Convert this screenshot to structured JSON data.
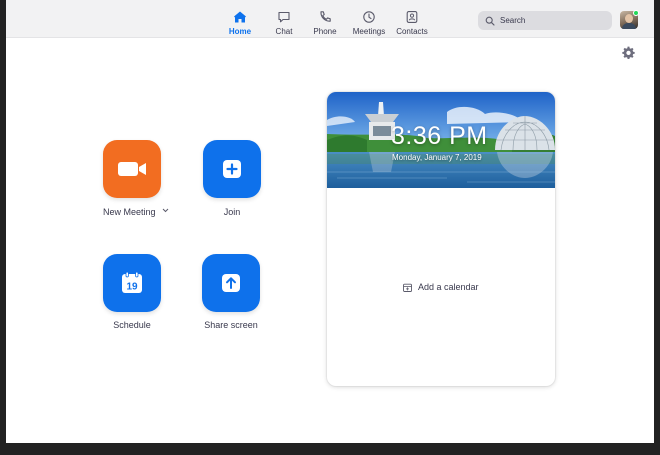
{
  "nav": {
    "tabs": [
      {
        "label": "Home",
        "icon": "home-icon",
        "active": true
      },
      {
        "label": "Chat",
        "icon": "chat-icon",
        "active": false
      },
      {
        "label": "Phone",
        "icon": "phone-icon",
        "active": false
      },
      {
        "label": "Meetings",
        "icon": "clock-icon",
        "active": false
      },
      {
        "label": "Contacts",
        "icon": "contacts-icon",
        "active": false
      }
    ],
    "search_placeholder": "Search"
  },
  "actions": [
    {
      "label": "New Meeting",
      "icon": "video-camera-icon",
      "has_dropdown": true
    },
    {
      "label": "Join",
      "icon": "plus-icon"
    },
    {
      "label": "Schedule",
      "icon": "calendar-icon",
      "calendar_day": "19"
    },
    {
      "label": "Share screen",
      "icon": "share-arrow-up-icon"
    }
  ],
  "card": {
    "time": "3:36 PM",
    "date": "Monday, January 7, 2019",
    "add_calendar_label": "Add a calendar"
  },
  "colors": {
    "accent": "#0e72ed",
    "new_meeting": "#f26d21",
    "action_blue": "#0e71eb",
    "status_online": "#23d959"
  }
}
